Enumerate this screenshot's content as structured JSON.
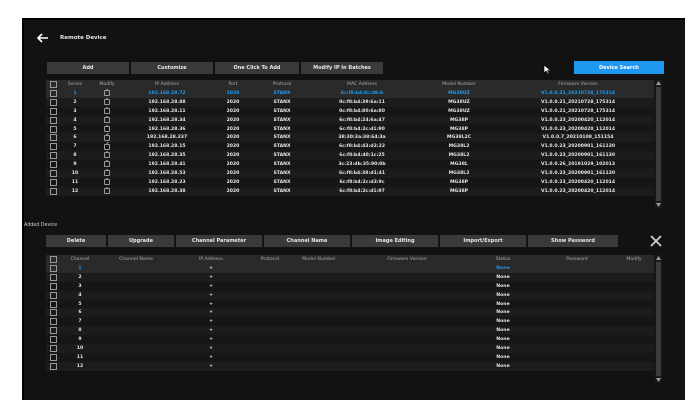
{
  "header": {
    "title": "Remote Device"
  },
  "toolbar": {
    "add": "Add",
    "customize": "Customize",
    "one_click_add": "One Click To Add",
    "modify_ip": "Modify IP In Batches",
    "device_search": "Device Search"
  },
  "remote_table": {
    "columns": [
      "",
      "Series",
      "Modify",
      "IP Address",
      "Port",
      "Protocol",
      "MAC Address",
      "Model Number",
      "Firmware Version"
    ],
    "rows": [
      {
        "series": "1",
        "ip": "192.168.28.72",
        "port": "2020",
        "protocol": "STANX",
        "mac": "6c:f8:b4:8c:d8:b",
        "model": "MG38UZ",
        "firmware": "V1.0.0.21_20210728_175314",
        "selected": true
      },
      {
        "series": "2",
        "ip": "192.168.28.88",
        "port": "2020",
        "protocol": "STANX",
        "mac": "0c:f8:b4:39:6a:11",
        "model": "MG38UZ",
        "firmware": "V1.0.0.21_20210728_175314"
      },
      {
        "series": "3",
        "ip": "192.168.28.11",
        "port": "2020",
        "protocol": "STANX",
        "mac": "0c:f8:b4:80:6a:80",
        "model": "MG38UZ",
        "firmware": "V1.0.0.21_20210728_175314"
      },
      {
        "series": "4",
        "ip": "192.168.28.34",
        "port": "2020",
        "protocol": "STANX",
        "mac": "6c:f8:b4:24:6a:47",
        "model": "MG38P",
        "firmware": "V1.0.0.23_20200420_112014"
      },
      {
        "series": "5",
        "ip": "192.168.28.36",
        "port": "2020",
        "protocol": "STANX",
        "mac": "6c:f8:b4:2c:d1:90",
        "model": "MG38P",
        "firmware": "V1.0.0.23_20200420_112014"
      },
      {
        "series": "6",
        "ip": "192.168.28.237",
        "port": "2020",
        "protocol": "STANX",
        "mac": "38:30:3a:38:64:3a",
        "model": "MG38L2C",
        "firmware": "V1.0.0.7_20210108_151154"
      },
      {
        "series": "7",
        "ip": "192.168.28.15",
        "port": "2020",
        "protocol": "STANX",
        "mac": "6c:f8:b4:43:d2:22",
        "model": "MG38L2",
        "firmware": "V1.0.0.23_20200901_161130"
      },
      {
        "series": "8",
        "ip": "192.168.28.35",
        "port": "2020",
        "protocol": "STANX",
        "mac": "6c:f8:b4:40:1c:25",
        "model": "MG38L2",
        "firmware": "V1.0.0.23_20200901_161130"
      },
      {
        "series": "9",
        "ip": "192.168.28.41",
        "port": "2020",
        "protocol": "STANX",
        "mac": "3c:23:db:35:90:0b",
        "model": "MG38L",
        "firmware": "V1.0.0.26_20191029_102013"
      },
      {
        "series": "10",
        "ip": "192.168.28.53",
        "port": "2020",
        "protocol": "STANX",
        "mac": "6c:f8:b4:38:d1:41",
        "model": "MG38L2",
        "firmware": "V1.0.0.23_20200901_161130"
      },
      {
        "series": "11",
        "ip": "192.168.28.23",
        "port": "2020",
        "protocol": "STANX",
        "mac": "6c:f8:b4:2c:d3:9c",
        "model": "MG38P",
        "firmware": "V1.0.0.23_20200420_112014"
      },
      {
        "series": "12",
        "ip": "192.168.28.38",
        "port": "2020",
        "protocol": "STANX",
        "mac": "6c:f8:b4:2c:d1:97",
        "model": "MG38P",
        "firmware": "V1.0.0.23_20200420_112014"
      }
    ]
  },
  "added": {
    "label": "Added Device",
    "buttons": {
      "delete": "Delete",
      "upgrade": "Upgrade",
      "channel_parameter": "Channel Parameter",
      "channel_name": "Channel Name",
      "image_editing": "Image Editing",
      "import_export": "Import/Export",
      "show_password": "Show Password"
    },
    "columns": [
      "",
      "Channel",
      "Channel Name",
      "IP Address",
      "Protocol",
      "Model Number",
      "Firmware Version",
      "Status",
      "Password",
      "Modify"
    ],
    "rows": [
      {
        "channel": "1",
        "ip": "+",
        "status": "None",
        "selected": true
      },
      {
        "channel": "2",
        "ip": "+",
        "status": "None"
      },
      {
        "channel": "3",
        "ip": "+",
        "status": "None"
      },
      {
        "channel": "4",
        "ip": "+",
        "status": "None"
      },
      {
        "channel": "5",
        "ip": "+",
        "status": "None"
      },
      {
        "channel": "6",
        "ip": "+",
        "status": "None"
      },
      {
        "channel": "7",
        "ip": "+",
        "status": "None"
      },
      {
        "channel": "8",
        "ip": "+",
        "status": "None"
      },
      {
        "channel": "9",
        "ip": "+",
        "status": "None"
      },
      {
        "channel": "10",
        "ip": "+",
        "status": "None"
      },
      {
        "channel": "11",
        "ip": "+",
        "status": "None"
      },
      {
        "channel": "12",
        "ip": "+",
        "status": "None"
      }
    ]
  },
  "colors": {
    "accent": "#1e97f0",
    "background": "#121212",
    "button": "#3a3a3a"
  }
}
